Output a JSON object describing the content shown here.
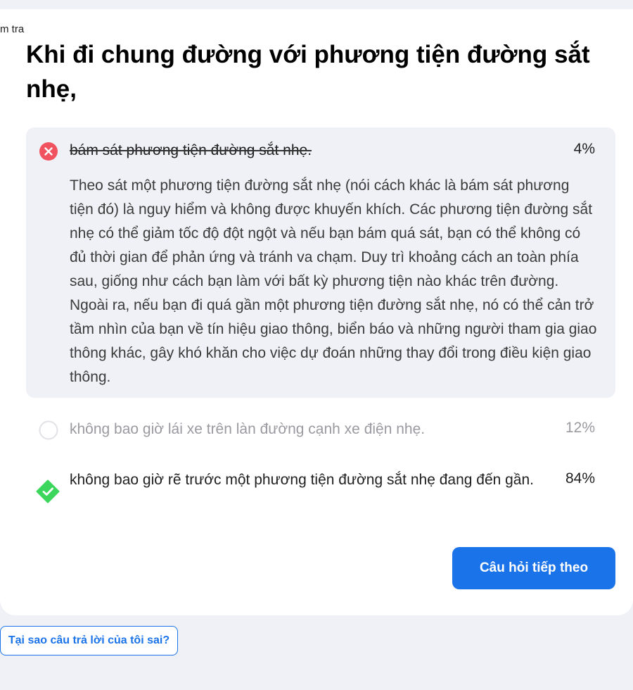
{
  "breadcrumb": "m tra",
  "question": "Khi đi chung đường với phương tiện đường sắt nhẹ,",
  "answers": [
    {
      "text": "bám sát phương tiện đường sắt nhẹ.",
      "percent": "4%",
      "state": "wrong-selected",
      "mark_icon": "x-circle-icon",
      "explanation": "Theo sát một phương tiện đường sắt nhẹ (nói cách khác là bám sát phương tiện đó) là nguy hiểm và không được khuyến khích. Các phương tiện đường sắt nhẹ có thể giảm tốc độ đột ngột và nếu bạn bám quá sát, bạn có thể không có đủ thời gian để phản ứng và tránh va chạm. Duy trì khoảng cách an toàn phía sau, giống như cách bạn làm với bất kỳ phương tiện nào khác trên đường. Ngoài ra, nếu bạn đi quá gần một phương tiện đường sắt nhẹ, nó có thể cản trở tầm nhìn của bạn về tín hiệu giao thông, biển báo và những người tham gia giao thông khác, gây khó khăn cho việc dự đoán những thay đổi trong điều kiện giao thông."
    },
    {
      "text": "không bao giờ lái xe trên làn đường cạnh xe điện nhẹ.",
      "percent": "12%",
      "state": "unselected",
      "mark_icon": "empty-circle-icon"
    },
    {
      "text": "không bao giờ rẽ trước một phương tiện đường sắt nhẹ đang đến gần.",
      "percent": "84%",
      "state": "correct",
      "mark_icon": "check-diamond-icon"
    }
  ],
  "buttons": {
    "next": "Câu hỏi tiếp theo",
    "why_wrong": "Tại sao câu trả lời của tôi sai?"
  },
  "colors": {
    "wrong": "#f0525f",
    "correct": "#3dd65c",
    "primary": "#1a73e8",
    "selected_bg": "#f0f1f6"
  }
}
